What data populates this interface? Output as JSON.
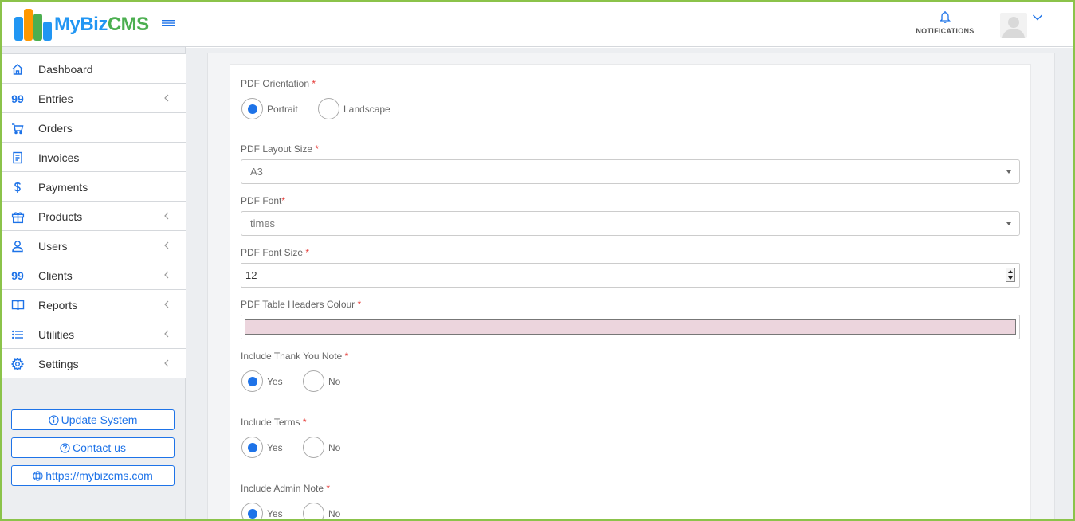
{
  "brand": {
    "name_part1": "My",
    "name_part2": "Biz",
    "name_part3": "CMS"
  },
  "header": {
    "notifications_label": "NOTIFICATIONS"
  },
  "sidebar": {
    "items": [
      {
        "label": "Dashboard",
        "icon": "home-icon",
        "has_children": false
      },
      {
        "label": "Entries",
        "icon": "quote-icon",
        "icon_text": "99",
        "has_children": true
      },
      {
        "label": "Orders",
        "icon": "cart-icon",
        "has_children": false
      },
      {
        "label": "Invoices",
        "icon": "receipt-icon",
        "has_children": false
      },
      {
        "label": "Payments",
        "icon": "dollar-icon",
        "has_children": false
      },
      {
        "label": "Products",
        "icon": "gift-icon",
        "has_children": true
      },
      {
        "label": "Users",
        "icon": "user-icon",
        "has_children": true
      },
      {
        "label": "Clients",
        "icon": "quote-icon",
        "icon_text": "99",
        "has_children": true
      },
      {
        "label": "Reports",
        "icon": "book-icon",
        "has_children": true
      },
      {
        "label": "Utilities",
        "icon": "list-icon",
        "has_children": true
      },
      {
        "label": "Settings",
        "icon": "gear-icon",
        "has_children": true
      }
    ],
    "buttons": {
      "update": "Update System",
      "contact": "Contact us",
      "website": "https://mybizcms.com"
    }
  },
  "form": {
    "required_mark": "*",
    "orientation": {
      "label": "PDF Orientation",
      "options": [
        "Portrait",
        "Landscape"
      ],
      "selected": "Portrait"
    },
    "layout_size": {
      "label": "PDF Layout Size",
      "value": "A3"
    },
    "font": {
      "label": "PDF Font",
      "value": "times"
    },
    "font_size": {
      "label": "PDF Font Size",
      "value": "12"
    },
    "header_colour": {
      "label": "PDF Table Headers Colour",
      "value": "#ecd5dd"
    },
    "thank_you_note": {
      "label": "Include Thank You Note",
      "options": [
        "Yes",
        "No"
      ],
      "selected": "Yes"
    },
    "terms": {
      "label": "Include Terms",
      "options": [
        "Yes",
        "No"
      ],
      "selected": "Yes"
    },
    "admin_note": {
      "label": "Include Admin Note",
      "options": [
        "Yes",
        "No"
      ],
      "selected": "Yes"
    }
  },
  "colors": {
    "accent": "#1e73e8",
    "brand_green": "#4caf50",
    "frame": "#8bc34a"
  }
}
